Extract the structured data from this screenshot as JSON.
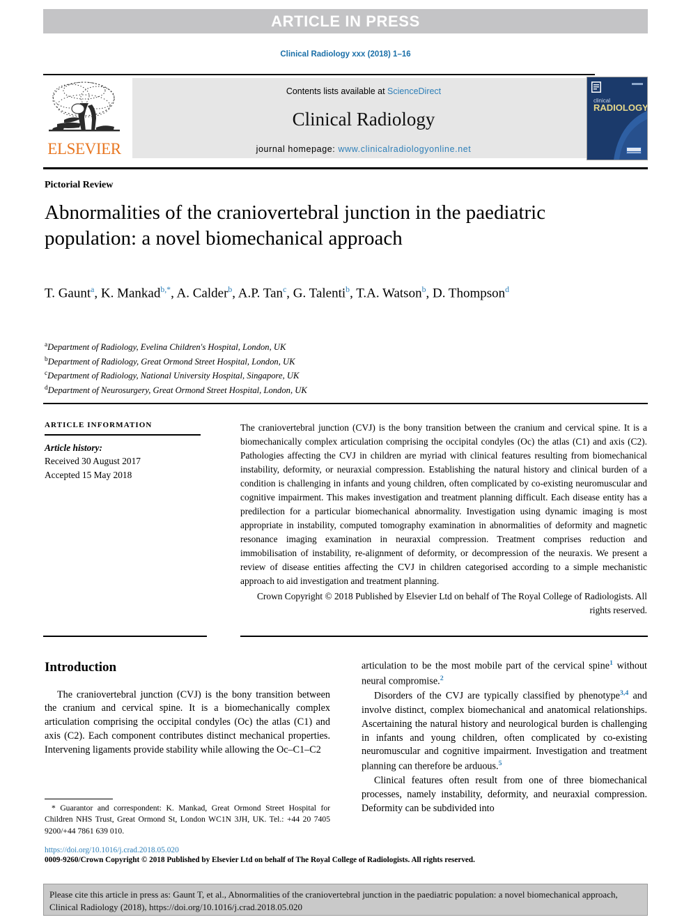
{
  "banner": {
    "text": "ARTICLE IN PRESS"
  },
  "running_head": "Clinical Radiology xxx (2018) 1–16",
  "masthead": {
    "publisher_logo_label": "ELSEVIER",
    "contents_prefix": "Contents lists available at ",
    "contents_link": "ScienceDirect",
    "journal_name": "Clinical Radiology",
    "homepage_prefix": "journal homepage: ",
    "homepage_url": "www.clinicalradiologyonline.net",
    "cover_title_line1": "clinical",
    "cover_title_line2": "RADIOLOGY"
  },
  "article": {
    "type": "Pictorial Review",
    "title": "Abnormalities of the craniovertebral junction in the paediatric population: a novel biomechanical approach",
    "authors": [
      {
        "name": "T. Gaunt",
        "marks": "a",
        "sep": ", "
      },
      {
        "name": "K. Mankad",
        "marks": "b,*",
        "sep": ", "
      },
      {
        "name": "A. Calder",
        "marks": "b",
        "sep": ", "
      },
      {
        "name": "A.P. Tan",
        "marks": "c",
        "sep": ", "
      },
      {
        "name": "G. Talenti",
        "marks": "b",
        "sep": ", "
      },
      {
        "name": "T.A. Watson",
        "marks": "b",
        "sep": ", "
      },
      {
        "name": "D. Thompson",
        "marks": "d",
        "sep": ""
      }
    ],
    "affiliations": [
      {
        "mark": "a",
        "text": "Department of Radiology, Evelina Children's Hospital, London, UK"
      },
      {
        "mark": "b",
        "text": "Department of Radiology, Great Ormond Street Hospital, London, UK"
      },
      {
        "mark": "c",
        "text": "Department of Radiology, National University Hospital, Singapore, UK"
      },
      {
        "mark": "d",
        "text": "Department of Neurosurgery, Great Ormond Street Hospital, London, UK"
      }
    ]
  },
  "article_information": {
    "heading": "ARTICLE INFORMATION",
    "history_label": "Article history:",
    "received": "Received 30 August 2017",
    "accepted": "Accepted 15 May 2018"
  },
  "abstract": {
    "body": "The craniovertebral junction (CVJ) is the bony transition between the cranium and cervical spine. It is a biomechanically complex articulation comprising the occipital condyles (Oc) the atlas (C1) and axis (C2). Pathologies affecting the CVJ in children are myriad with clinical features resulting from biomechanical instability, deformity, or neuraxial compression. Establishing the natural history and clinical burden of a condition is challenging in infants and young children, often complicated by co-existing neuromuscular and cognitive impairment. This makes investigation and treatment planning difficult. Each disease entity has a predilection for a particular biomechanical abnormality. Investigation using dynamic imaging is most appropriate in instability, computed tomography examination in abnormalities of deformity and magnetic resonance imaging examination in neuraxial compression. Treatment comprises reduction and immobilisation of instability, re-alignment of deformity, or decompression of the neuraxis. We present a review of disease entities affecting the CVJ in children categorised according to a simple mechanistic approach to aid investigation and treatment planning.",
    "copyright": "Crown Copyright © 2018 Published by Elsevier Ltd on behalf of The Royal College of Radiologists. All rights reserved."
  },
  "body": {
    "introduction_heading": "Introduction",
    "left_para_1": "The craniovertebral junction (CVJ) is the bony transition between the cranium and cervical spine. It is a biomechanically complex articulation comprising the occipital condyles (Oc) the atlas (C1) and axis (C2). Each component contributes distinct mechanical properties. Intervening ligaments provide stability while allowing the Oc–C1–C2",
    "right_para_1a": "articulation to be the most mobile part of the cervical spine",
    "right_para_1_ref1": "1",
    "right_para_1b": " without neural compromise.",
    "right_para_1_ref2": "2",
    "right_para_2a": "Disorders of the CVJ are typically classified by phenotype",
    "right_para_2_ref1": "3,4",
    "right_para_2b": " and involve distinct, complex biomechanical and anatomical relationships. Ascertaining the natural history and neurological burden is challenging in infants and young children, often complicated by co-existing neuromuscular and cognitive impairment. Investigation and treatment planning can therefore be arduous.",
    "right_para_2_ref2": "5",
    "right_para_3": "Clinical features often result from one of three biomechanical processes, namely instability, deformity, and neuraxial compression. Deformity can be subdivided into"
  },
  "footnote": {
    "text": "* Guarantor and correspondent: K. Mankad, Great Ormond Street Hospital for Children NHS Trust, Great Ormond St, London WC1N 3JH, UK. Tel.: +44 20 7405 9200/+44 7861 639 010."
  },
  "doi_block": {
    "doi": "https://doi.org/10.1016/j.crad.2018.05.020",
    "issn_line": "0009-9260/Crown Copyright © 2018 Published by Elsevier Ltd on behalf of The Royal College of Radiologists. All rights reserved."
  },
  "cite_box": {
    "text": "Please cite this article in press as: Gaunt T, et al., Abnormalities of the craniovertebral junction in the paediatric population: a novel biomechanical approach, Clinical Radiology (2018), https://doi.org/10.1016/j.crad.2018.05.020"
  },
  "colors": {
    "banner_bg": "#c4c4c6",
    "link_blue": "#2e7fb8",
    "elsevier_orange": "#e87722",
    "contents_bg": "#e6e6e6",
    "cite_box_bg": "#c9c9c9"
  }
}
